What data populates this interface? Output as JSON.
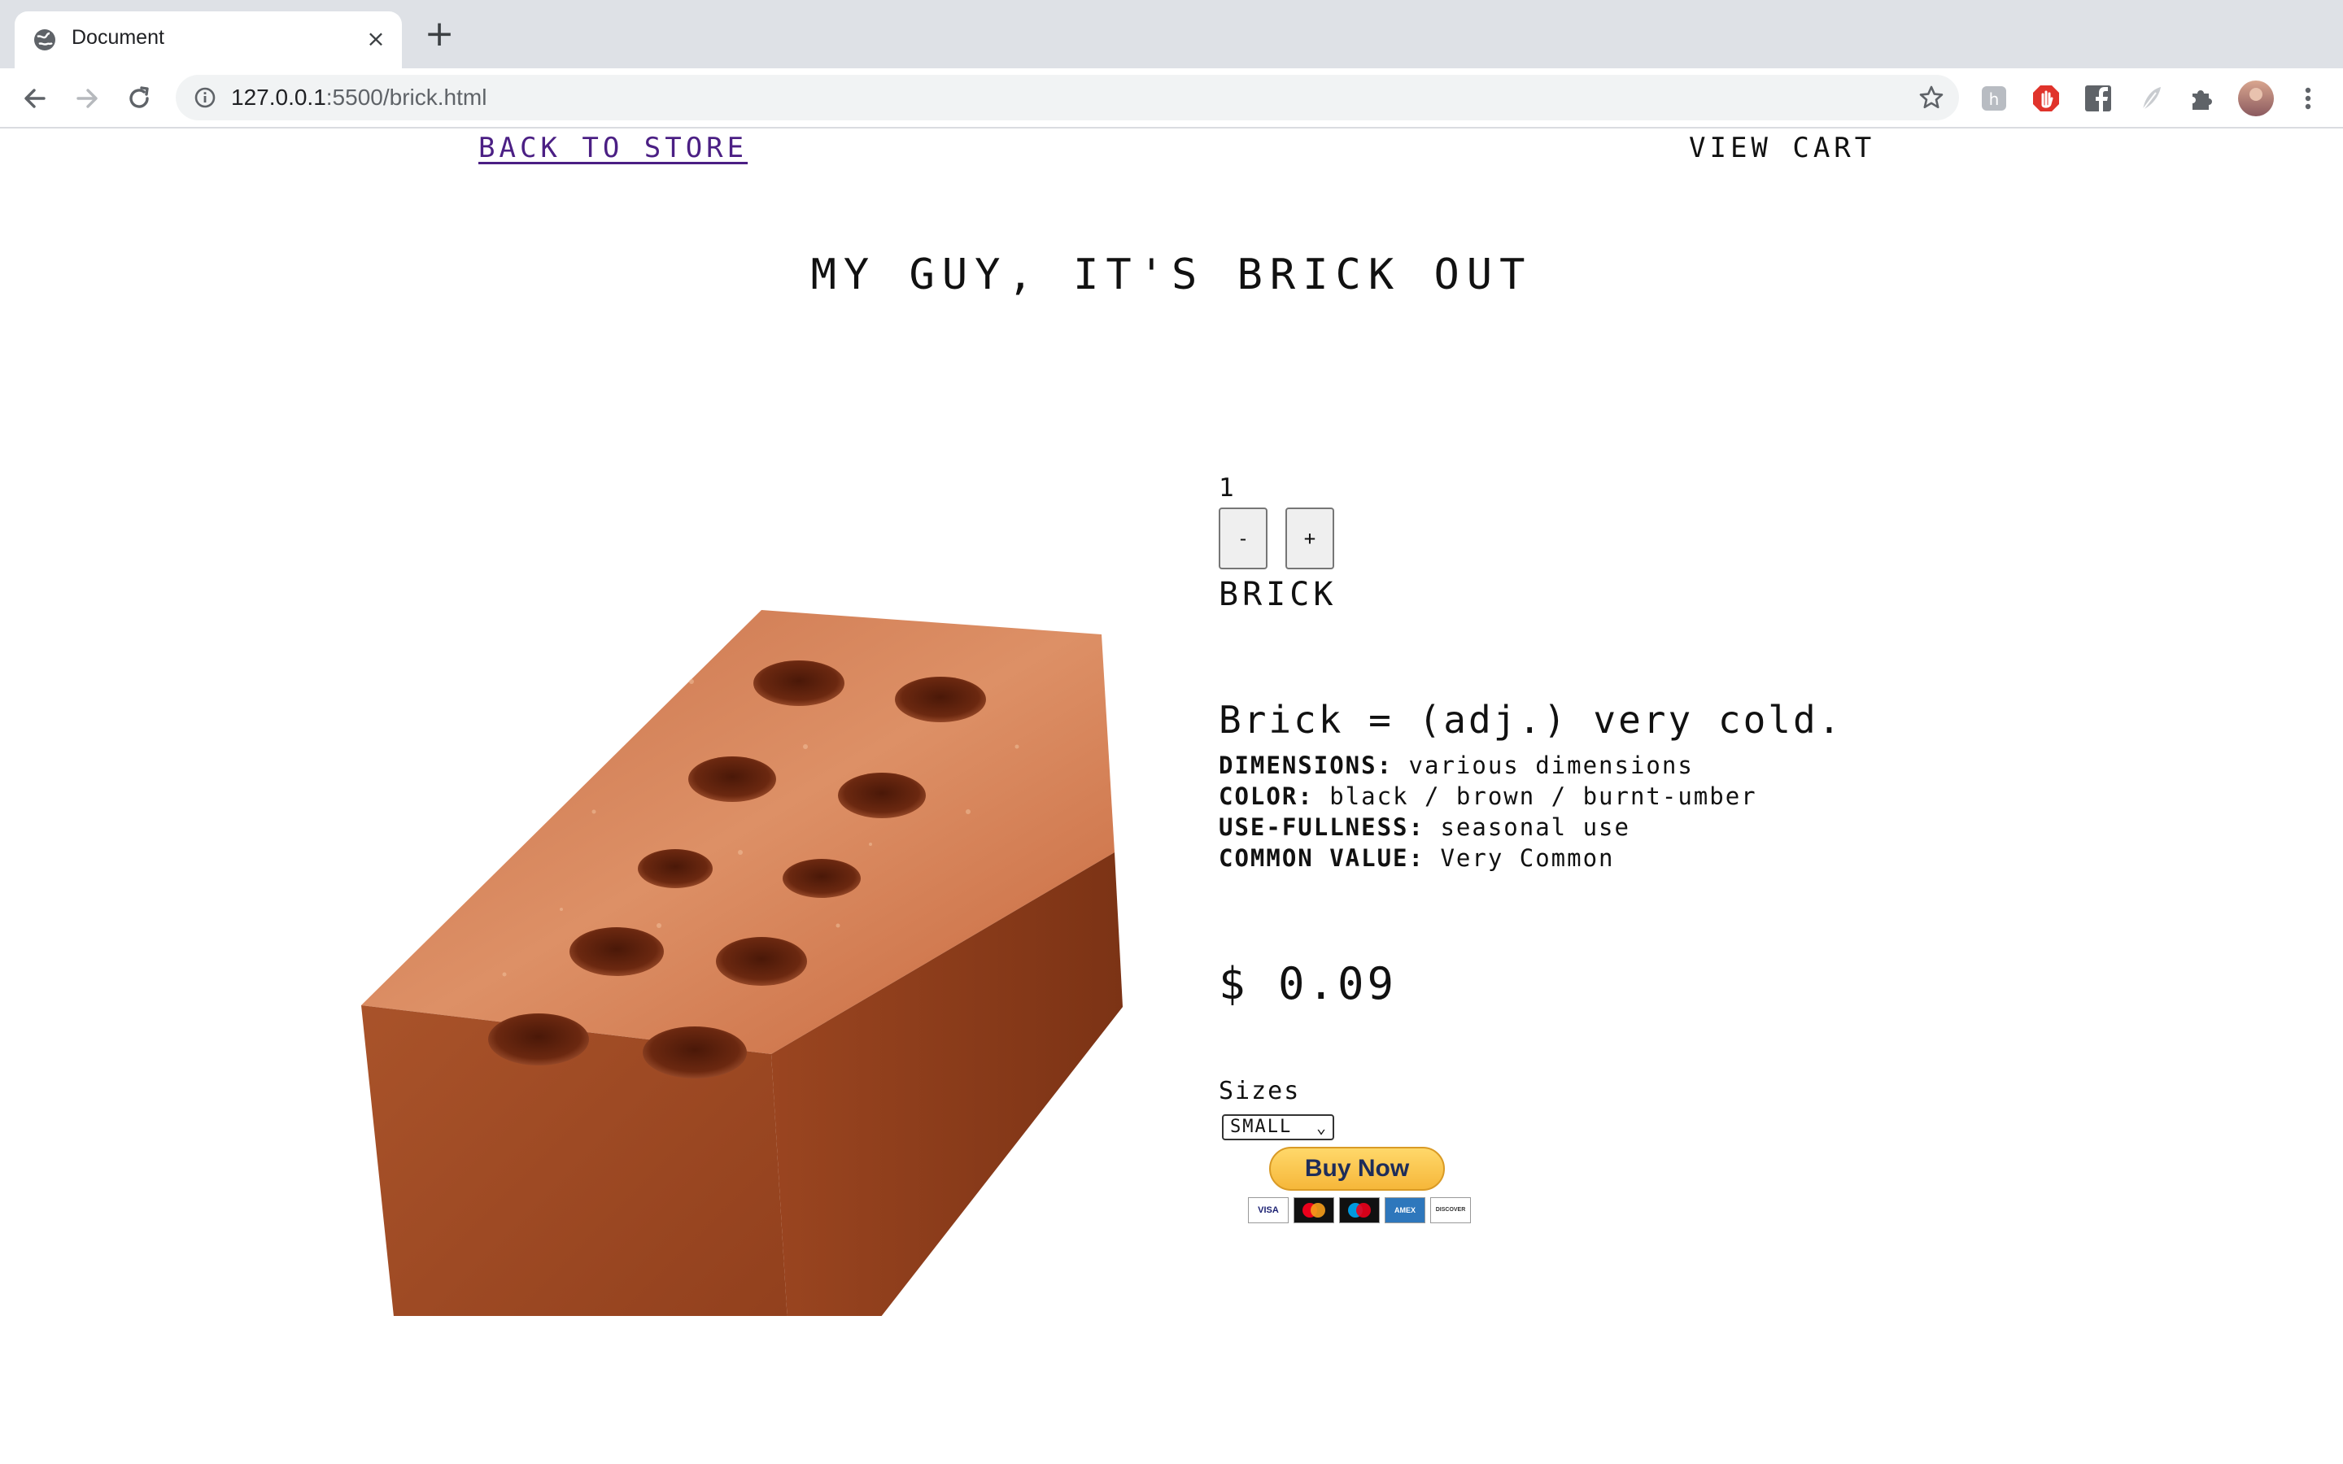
{
  "browser": {
    "tab_title": "Document",
    "url_host": "127.0.0.1",
    "url_path": ":5500/brick.html",
    "new_tab_symbol": "+",
    "close_symbol": "×",
    "extension_icons": [
      "honey-icon",
      "adblock-icon",
      "facebook-icon",
      "feather-icon",
      "puzzle-extensions-icon",
      "profile-avatar"
    ]
  },
  "nav": {
    "back_to_store": "BACK TO STORE",
    "view_cart": "VIEW CART"
  },
  "headline": "MY GUY, IT'S BRICK OUT",
  "product": {
    "quantity": "1",
    "decrement_label": "-",
    "increment_label": "+",
    "name": "BRICK",
    "tagline": "Brick = (adj.) very cold.",
    "specs": [
      {
        "label": "DIMENSIONS:",
        "value": "various dimensions"
      },
      {
        "label": "COLOR:",
        "value": "black / brown / burnt-umber"
      },
      {
        "label": "USE-FULLNESS:",
        "value": "seasonal use"
      },
      {
        "label": "COMMON VALUE:",
        "value": "Very Common"
      }
    ],
    "price": "$ 0.09",
    "sizes_label": "Sizes",
    "size_selected": "SMALL",
    "buy_now": "Buy Now",
    "cards": [
      "VISA",
      "MC",
      "MAESTRO",
      "AMEX",
      "DISCOVER"
    ]
  },
  "colors": {
    "link_visited": "#4b1f84",
    "brick_top": "#d98a5c",
    "brick_side": "#a24a22",
    "paypal_gold": "#f7bd45"
  }
}
